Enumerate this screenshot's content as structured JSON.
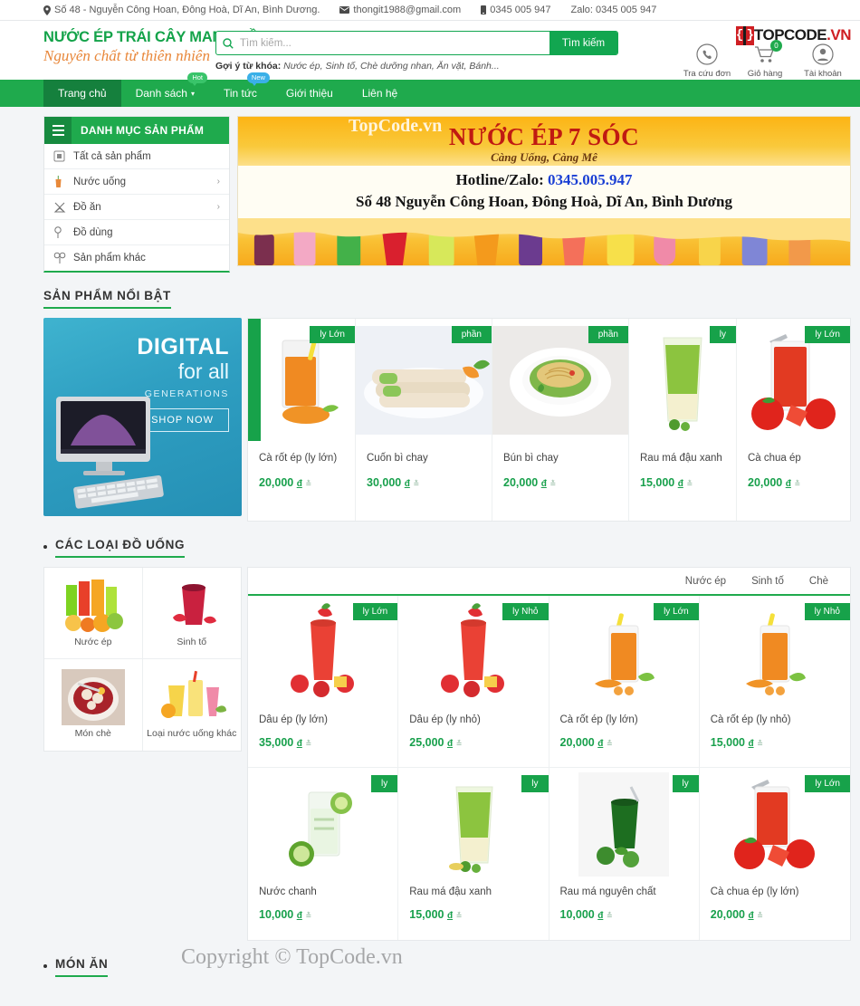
{
  "topbar": {
    "address": "Số 48 - Nguyễn Công Hoan, Đông Hoà, Dĩ An, Bình Dương.",
    "email": "thongit1988@gmail.com",
    "phone": "0345 005 947",
    "zalo": "Zalo: 0345 005 947",
    "location_icon": "location-pin-icon",
    "email_icon": "envelope-icon",
    "phone_icon": "mobile-phone-icon"
  },
  "logo": {
    "line1": "NƯỚC ÉP TRÁI CÂY MANG VỀ",
    "line2": "Nguyên chất từ thiên nhiên"
  },
  "search": {
    "placeholder": "Tìm kiếm...",
    "value": "",
    "button": "Tìm kiếm",
    "keywords_label": "Gợi ý từ khóa:",
    "keywords_value": "Nước ép, Sinh tố, Chè dưỡng nhan, Ăn vặt, Bánh..."
  },
  "brand_watermark": {
    "top": "TOP",
    "code": "CODE",
    "vn": ".VN",
    "header_overlay": "TopCode.vn",
    "copyright": "Copyright © TopCode.vn"
  },
  "head_icons": [
    {
      "label": "Tra cứu đơn hàng",
      "icon": "phone-search-icon",
      "badge": ""
    },
    {
      "label": "Giỏ hàng",
      "icon": "shopping-cart-icon",
      "badge": "0"
    },
    {
      "label": "Tài khoản",
      "icon": "user-account-icon",
      "badge": ""
    }
  ],
  "nav": [
    {
      "label": "Trang chủ",
      "active": true,
      "badge": "",
      "caret": false
    },
    {
      "label": "Danh sách",
      "active": false,
      "badge": "Hot",
      "badge_type": "hot",
      "caret": true
    },
    {
      "label": "Tin tức",
      "active": false,
      "badge": "New",
      "badge_type": "new",
      "caret": false
    },
    {
      "label": "Giới thiệu",
      "active": false,
      "badge": "",
      "caret": false
    },
    {
      "label": "Liên hệ",
      "active": false,
      "badge": "",
      "caret": false
    }
  ],
  "category_box": {
    "title": "DANH MỤC SẢN PHẨM",
    "items": [
      {
        "label": "Tất cả sản phẩm",
        "icon": "grid-all-products-icon",
        "arrow": false
      },
      {
        "label": "Nước uống",
        "icon": "drink-cup-icon",
        "arrow": true
      },
      {
        "label": "Đồ ăn",
        "icon": "food-bowl-icon",
        "arrow": true
      },
      {
        "label": "Đồ dùng",
        "icon": "utensil-icon",
        "arrow": false
      },
      {
        "label": "Sản phẩm khác",
        "icon": "other-products-icon",
        "arrow": false
      }
    ]
  },
  "banner": {
    "title": "NƯỚC ÉP 7 SÓC",
    "slogan": "Càng Uống, Càng Mê",
    "hotline_label": "Hotline/Zalo:",
    "hotline_number": "0345.005.947",
    "address": "Số 48 Nguyễn Công Hoan, Đông Hoà, Dĩ An, Bình Dương"
  },
  "featured": {
    "title": "SẢN PHẨM NỔI BẬT",
    "side_ad": {
      "title": "DIGITAL",
      "subtitle": "for all",
      "tagline": "GENERATIONS",
      "button": "SHOP NOW"
    },
    "products": [
      {
        "name": "Cà rốt ép (ly lớn)",
        "price": "20,000",
        "currency": "đ",
        "badge": "ly Lớn",
        "image": "carrot-juice-image"
      },
      {
        "name": "Cuốn bì chay",
        "price": "30,000",
        "currency": "đ",
        "badge": "phần",
        "image": "spring-rolls-image"
      },
      {
        "name": "Bún bì chay",
        "price": "20,000",
        "currency": "đ",
        "badge": "phần",
        "image": "noodle-salad-image"
      },
      {
        "name": "Rau má đậu xanh",
        "price": "15,000",
        "currency": "đ",
        "badge": "ly",
        "image": "pennywort-mungbean-image"
      },
      {
        "name": "Cà chua ép",
        "price": "20,000",
        "currency": "đ",
        "badge": "ly Lớn",
        "image": "tomato-juice-image"
      }
    ]
  },
  "drinks": {
    "title": "CÁC LOẠI ĐỒ UỐNG",
    "tiles": [
      {
        "label": "Nước ép",
        "image": "mixed-juice-glasses-image"
      },
      {
        "label": "Sinh tố",
        "image": "strawberry-smoothie-image"
      },
      {
        "label": "Món chè",
        "image": "che-dessert-bowl-image"
      },
      {
        "label": "Loại nước uống khác",
        "image": "other-drinks-image"
      }
    ],
    "tabs": [
      {
        "label": "Nước ép",
        "active": true
      },
      {
        "label": "Sinh tố",
        "active": false
      },
      {
        "label": "Chè",
        "active": false
      }
    ],
    "products": [
      {
        "name": "Dâu ép (ly lớn)",
        "price": "35,000",
        "currency": "đ",
        "badge": "ly Lớn",
        "image": "strawberry-juice-large-image"
      },
      {
        "name": "Dâu ép (ly nhỏ)",
        "price": "25,000",
        "currency": "đ",
        "badge": "ly Nhỏ",
        "image": "strawberry-juice-small-image"
      },
      {
        "name": "Cà rốt ép (ly lớn)",
        "price": "20,000",
        "currency": "đ",
        "badge": "ly Lớn",
        "image": "carrot-juice-large-image"
      },
      {
        "name": "Cà rốt ép (ly nhỏ)",
        "price": "15,000",
        "currency": "đ",
        "badge": "ly Nhỏ",
        "image": "carrot-juice-small-image"
      },
      {
        "name": "Nước chanh",
        "price": "10,000",
        "currency": "đ",
        "badge": "ly",
        "image": "lemonade-image"
      },
      {
        "name": "Rau má đậu xanh",
        "price": "15,000",
        "currency": "đ",
        "badge": "ly",
        "image": "pennywort-mungbean-image"
      },
      {
        "name": "Rau má nguyên chất",
        "price": "10,000",
        "currency": "đ",
        "badge": "ly",
        "image": "pure-pennywort-image"
      },
      {
        "name": "Cà chua ép (ly lớn)",
        "price": "20,000",
        "currency": "đ",
        "badge": "ly Lớn",
        "image": "tomato-juice-large-image"
      }
    ]
  },
  "food_section": {
    "title": "MÓN ĂN"
  },
  "colors": {
    "brand_green": "#1faa4d",
    "dark_green": "#15803d",
    "orange": "#e8873a",
    "banner_yellow": "#f9c134",
    "banner_red": "#c01a12",
    "price_green": "#18a04c"
  }
}
